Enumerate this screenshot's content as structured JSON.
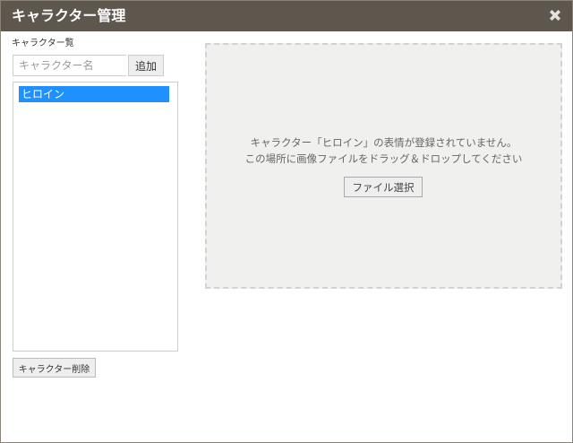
{
  "dialog": {
    "title": "キャラクター管理",
    "close_icon": "close-icon"
  },
  "sidebar": {
    "list_label": "キャラクター覧",
    "name_input_placeholder": "キャラクター名",
    "name_input_value": "",
    "add_button_label": "追加",
    "characters": [
      {
        "name": "ヒロイン",
        "selected": true
      }
    ],
    "delete_button_label": "キャラクター削除"
  },
  "dropzone": {
    "message_line1": "キャラクター「ヒロイン」の表情が登録されていません。",
    "message_line2": "この場所に画像ファイルをドラッグ＆ドロップしてください",
    "file_button_label": "ファイル選択"
  },
  "colors": {
    "titlebar": "#5d574e",
    "selection": "#1e90ff",
    "dropzone_bg": "#f0f0ee"
  }
}
